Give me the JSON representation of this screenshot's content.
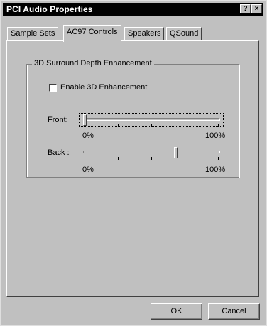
{
  "window": {
    "title": "PCI Audio Properties",
    "help_glyph": "?",
    "close_glyph": "×"
  },
  "tabs": [
    {
      "label": "Sample Sets",
      "active": false
    },
    {
      "label": "AC97 Controls",
      "active": true
    },
    {
      "label": "Speakers",
      "active": false
    },
    {
      "label": "QSound",
      "active": false
    }
  ],
  "group": {
    "label": "3D Surround Depth Enhancement",
    "checkbox_label": "Enable 3D Enhancement",
    "checkbox_checked": false
  },
  "sliders": [
    {
      "label": "Front:",
      "value_fraction": 0.0,
      "min_label": "0%",
      "max_label": "100%"
    },
    {
      "label": "Back :",
      "value_fraction": 0.68,
      "min_label": "0%",
      "max_label": "100%"
    }
  ],
  "buttons": {
    "ok": "OK",
    "cancel": "Cancel"
  }
}
